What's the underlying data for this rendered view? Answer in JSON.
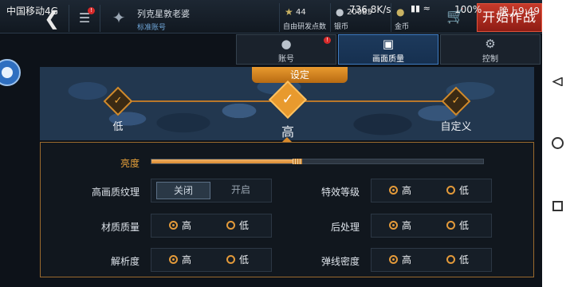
{
  "statusbar": {
    "carrier": "中国移动4G",
    "speed": "736.8K/s",
    "battery": "100%",
    "clock": "晚上9:49"
  },
  "topbar": {
    "back_icon": "back-chevron-icon",
    "menu_icon": "list-menu-icon",
    "menu_badge": "!",
    "player_name": "列克星敦老婆",
    "account_type": "标准账号",
    "resources": [
      {
        "icon": "star-icon",
        "value": "44",
        "label": "自由研发点数"
      },
      {
        "icon": "silver-coin-icon",
        "value": "20085",
        "label": "银币"
      },
      {
        "icon": "gold-coin-icon",
        "value": "",
        "label": "金币"
      }
    ],
    "start_button": "开始作战"
  },
  "tabs": [
    {
      "label": "账号",
      "icon": "user-icon",
      "badge": "!",
      "active": false
    },
    {
      "label": "画面质量",
      "icon": "image-icon",
      "badge": "",
      "active": true
    },
    {
      "label": "控制",
      "icon": "gear-icon",
      "badge": "",
      "active": false
    }
  ],
  "preset": {
    "title": "设定",
    "options": [
      {
        "label": "低",
        "selected": false
      },
      {
        "label": "高",
        "selected": true
      },
      {
        "label": "自定义",
        "selected": false
      }
    ]
  },
  "settings": {
    "brightness": {
      "label": "亮度",
      "level": 0.45
    },
    "hd_texture": {
      "label": "高画质纹理",
      "options": [
        "关闭",
        "开启"
      ],
      "selected": "关闭"
    },
    "effects_level": {
      "label": "特效等级",
      "options": [
        "高",
        "低"
      ],
      "selected": "高"
    },
    "material_quality": {
      "label": "材质质量",
      "options": [
        "高",
        "低"
      ],
      "selected": "高"
    },
    "post_processing": {
      "label": "后处理",
      "options": [
        "高",
        "低"
      ],
      "selected": "高"
    },
    "resolution": {
      "label": "解析度",
      "options": [
        "高",
        "低"
      ],
      "selected": "高"
    },
    "tracer_density": {
      "label": "弹线密度",
      "options": [
        "高",
        "低"
      ],
      "selected": "高"
    }
  }
}
